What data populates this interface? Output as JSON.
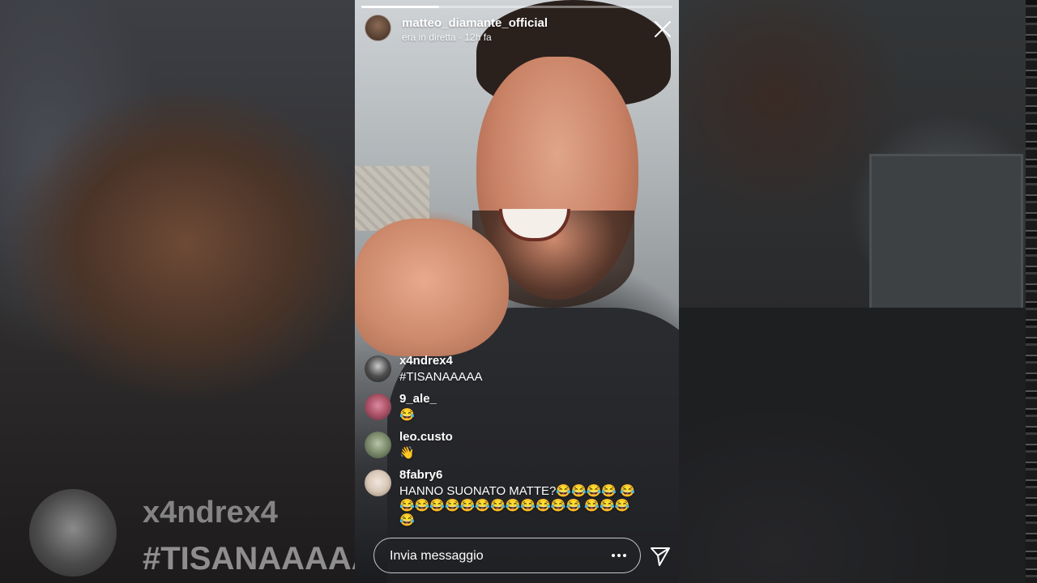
{
  "story": {
    "progress": 0.25,
    "username": "matteo_diamante_official",
    "status": "era in diretta · 12h fa",
    "close_icon": "close-icon"
  },
  "comments": [
    {
      "user": "x4ndrex4",
      "text": "#TISANAAAAA",
      "avatar_color": "#3a3a3a"
    },
    {
      "user": "9_ale_",
      "text": "😂",
      "avatar_color": "#b0566a"
    },
    {
      "user": "leo.custo",
      "text": "👋",
      "avatar_color": "#7a8a6a"
    },
    {
      "user": "8fabry6",
      "text": "HANNO SUONATO MATTE?😂😂😂😂 😂😂😂😂😂😂😂😂😂😂😂😂😂 😂😂😂😂",
      "avatar_color": "#d8c8b8"
    }
  ],
  "message_bar": {
    "placeholder": "Invia messaggio",
    "more_icon": "more-dots-icon",
    "send_icon": "send-icon"
  },
  "background_overlay": {
    "user": "x4ndrex4",
    "text": "#TISANAAAAA"
  }
}
